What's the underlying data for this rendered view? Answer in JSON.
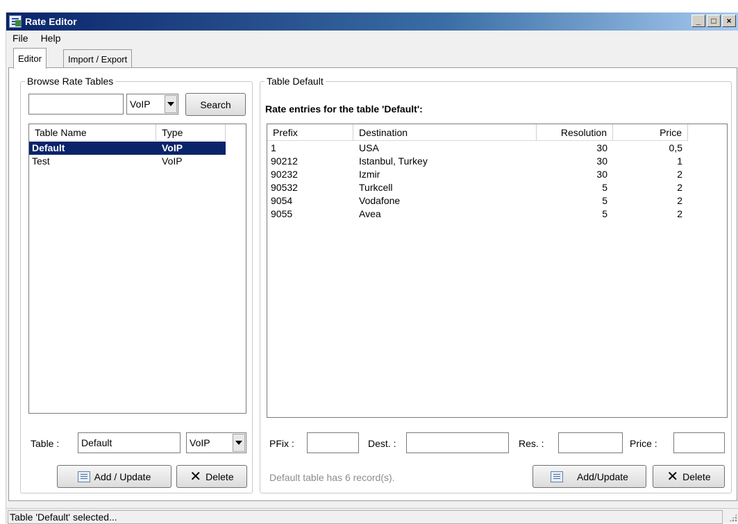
{
  "window": {
    "title": "Rate Editor",
    "controls": [
      "_",
      "□",
      "×"
    ]
  },
  "menu": [
    "File",
    "Help"
  ],
  "tabs": [
    {
      "label": "Editor",
      "active": true
    },
    {
      "label": "Import / Export",
      "active": false
    }
  ],
  "browse": {
    "group_title": "Browse Rate Tables",
    "search_value": "",
    "type_filter": "VoIP",
    "search_label": "Search",
    "columns": [
      "Table Name",
      "Type"
    ],
    "rows": [
      {
        "name": "Default",
        "type": "VoIP",
        "selected": true
      },
      {
        "name": "Test",
        "type": "VoIP",
        "selected": false
      }
    ],
    "table_label": "Table :",
    "table_value": "Default",
    "table_type": "VoIP",
    "add_update_label": "Add / Update",
    "delete_label": "Delete"
  },
  "table_default": {
    "group_title": "Table Default",
    "heading": "Rate entries for the table 'Default':",
    "columns": [
      "Prefix",
      "Destination",
      "Resolution",
      "Price"
    ],
    "rows": [
      {
        "prefix": "1",
        "destination": "USA",
        "resolution": "30",
        "price": "0,5"
      },
      {
        "prefix": "90212",
        "destination": "Istanbul, Turkey",
        "resolution": "30",
        "price": "1"
      },
      {
        "prefix": "90232",
        "destination": "Izmir",
        "resolution": "30",
        "price": "2"
      },
      {
        "prefix": "90532",
        "destination": "Turkcell",
        "resolution": "5",
        "price": "2"
      },
      {
        "prefix": "9054",
        "destination": "Vodafone",
        "resolution": "5",
        "price": "2"
      },
      {
        "prefix": "9055",
        "destination": "Avea",
        "resolution": "5",
        "price": "2"
      }
    ],
    "pfix_label": "PFix :",
    "pfix_value": "",
    "dest_label": "Dest. :",
    "dest_value": "",
    "res_label": "Res. :",
    "res_value": "",
    "price_label": "Price :",
    "price_value": "",
    "record_info": "Default table has 6 record(s).",
    "add_update_label": "Add/Update",
    "delete_label": "Delete"
  },
  "status": "Table 'Default' selected...",
  "colors": {
    "title_gradient_start": "#0a246a",
    "selection": "#0a246a",
    "disabled_text": "#8c8c8c"
  }
}
